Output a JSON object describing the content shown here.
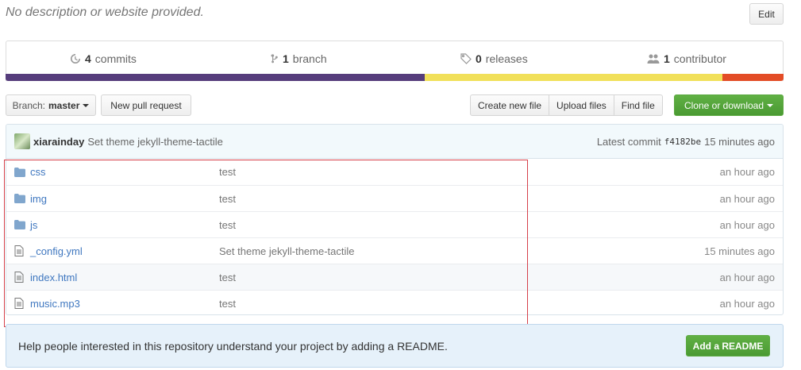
{
  "repo": {
    "description": "No description or website provided.",
    "edit_label": "Edit"
  },
  "numbers": {
    "commits": {
      "count": "4",
      "label": "commits"
    },
    "branch": {
      "count": "1",
      "label": "branch"
    },
    "releases": {
      "count": "0",
      "label": "releases"
    },
    "contributor": {
      "count": "1",
      "label": "contributor"
    }
  },
  "language_bar": [
    {
      "color": "#563d7c",
      "fraction": 0.539
    },
    {
      "color": "#f1e05a",
      "fraction": 0.382
    },
    {
      "color": "#e34c26",
      "fraction": 0.079
    }
  ],
  "toolbar": {
    "branch_label": "Branch:",
    "branch_value": "master",
    "new_pr": "New pull request",
    "create_file": "Create new file",
    "upload_files": "Upload files",
    "find_file": "Find file",
    "clone": "Clone or download"
  },
  "commit": {
    "author": "xiarainday",
    "message": "Set theme jekyll-theme-tactile",
    "latest_label": "Latest commit",
    "sha": "f4182be",
    "time": "15 minutes ago"
  },
  "files": [
    {
      "type": "dir",
      "icon": "folder-icon",
      "name": "css",
      "message": "test",
      "age": "an hour ago"
    },
    {
      "type": "dir",
      "icon": "folder-icon",
      "name": "img",
      "message": "test",
      "age": "an hour ago"
    },
    {
      "type": "dir",
      "icon": "folder-icon",
      "name": "js",
      "message": "test",
      "age": "an hour ago"
    },
    {
      "type": "file",
      "icon": "file-icon",
      "name": "_config.yml",
      "message": "Set theme jekyll-theme-tactile",
      "age": "15 minutes ago"
    },
    {
      "type": "file",
      "icon": "file-icon",
      "name": "index.html",
      "message": "test",
      "age": "an hour ago"
    },
    {
      "type": "file",
      "icon": "file-icon",
      "name": "music.mp3",
      "message": "test",
      "age": "an hour ago"
    }
  ],
  "readme": {
    "text": "Help people interested in this repository understand your project by adding a README.",
    "button": "Add a README"
  }
}
